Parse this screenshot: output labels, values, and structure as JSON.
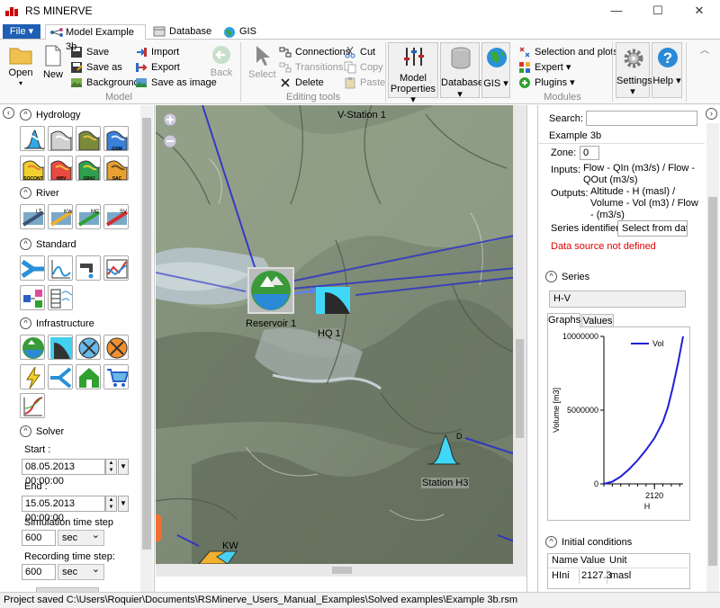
{
  "window": {
    "title": "RS MINERVE",
    "minimize": "—",
    "maximize": "☐",
    "close": "✕"
  },
  "tabs": {
    "file": "File ▾",
    "items": [
      "Model Example 3b",
      "Database",
      "GIS"
    ]
  },
  "ribbon": {
    "open": "Open",
    "new": "New",
    "save": "Save",
    "save_as": "Save as",
    "background": "Background",
    "import": "Import",
    "export": "Export",
    "save_image": "Save as image",
    "back": "Back",
    "model_group": "Model",
    "select": "Select",
    "connections": "Connections",
    "transitions": "Transitions",
    "delete": "Delete",
    "cut": "Cut",
    "copy": "Copy",
    "paste": "Paste",
    "editing_group": "Editing tools",
    "model_properties": "Model Properties ▾",
    "database": "Database ▾",
    "gis": "GIS ▾",
    "selection_plots": "Selection and plots",
    "expert": "Expert ▾",
    "plugins": "Plugins ▾",
    "modules_group": "Modules",
    "settings": "Settings ▾",
    "help": "Help ▾"
  },
  "left": {
    "hydrology": "Hydrology",
    "hydro_tools": [
      "",
      "",
      "",
      "GSM",
      "SOCONT",
      "HBV",
      "GR4J",
      "SAC"
    ],
    "river": "River",
    "river_tools": [
      "LT",
      "KW",
      "MC",
      "SV"
    ],
    "standard": "Standard",
    "infrastructure": "Infrastructure",
    "solver": "Solver",
    "start_label": "Start :",
    "start_value": "08.05.2013 00:00:00",
    "end_label": "End :",
    "end_value": "15.05.2013 00:00:00",
    "sim_step_label": "Simulation time step",
    "sim_step_value": "600",
    "sim_step_unit": "sec",
    "rec_step_label": "Recording time step:",
    "rec_step_value": "600",
    "rec_step_unit": "sec"
  },
  "map": {
    "station_v": "V-Station 1",
    "reservoir": "Reservoir 1",
    "hq": "HQ 1",
    "station_h3": "Station H3",
    "kw": "KW",
    "d_mark": "D"
  },
  "right": {
    "search_label": "Search:",
    "search_value": "",
    "object_name": "Example 3b",
    "zone_label": "Zone:",
    "zone_value": "0",
    "inputs_label": "Inputs:",
    "inputs_value": "Flow - QIn (m3/s) / Flow - QOut (m3/s)",
    "outputs_label": "Outputs:",
    "outputs_value": "Altitude - H (masl) / Volume - Vol (m3) / Flow - (m3/s)",
    "series_id_label": "Series identifier:",
    "series_id_value": "Select from datal",
    "error": "Data source not defined",
    "series_section": "Series",
    "series_name": "H-V",
    "graph_tabs": [
      "Graphs",
      "Values"
    ],
    "initial_section": "Initial conditions",
    "ic_headers": [
      "Name",
      "Value",
      "Unit"
    ],
    "ic_row": [
      "HIni",
      "2127.3",
      "masl"
    ]
  },
  "chart_data": {
    "type": "line",
    "x": [
      2090,
      2095,
      2100,
      2105,
      2110,
      2115,
      2120,
      2125,
      2128,
      2131,
      2134,
      2137
    ],
    "series": [
      {
        "name": "Vol",
        "values": [
          0,
          150000,
          500000,
          1000000,
          1600000,
          2300000,
          3100000,
          4200000,
          5200000,
          6600000,
          8200000,
          10000000
        ]
      }
    ],
    "xlabel": "H",
    "ylabel": "Volume [m3]",
    "xticks": [
      "2120"
    ],
    "yticks": [
      "0",
      "5000000",
      "10000000"
    ],
    "xlim": [
      2090,
      2137
    ],
    "ylim": [
      0,
      10000000
    ],
    "legend": "top-right",
    "color": "#1f1fd8"
  },
  "status": "Project saved C:\\Users\\Roquier\\Documents\\RSMinerve_Users_Manual_Examples\\Solved examples\\Example 3b.rsm"
}
